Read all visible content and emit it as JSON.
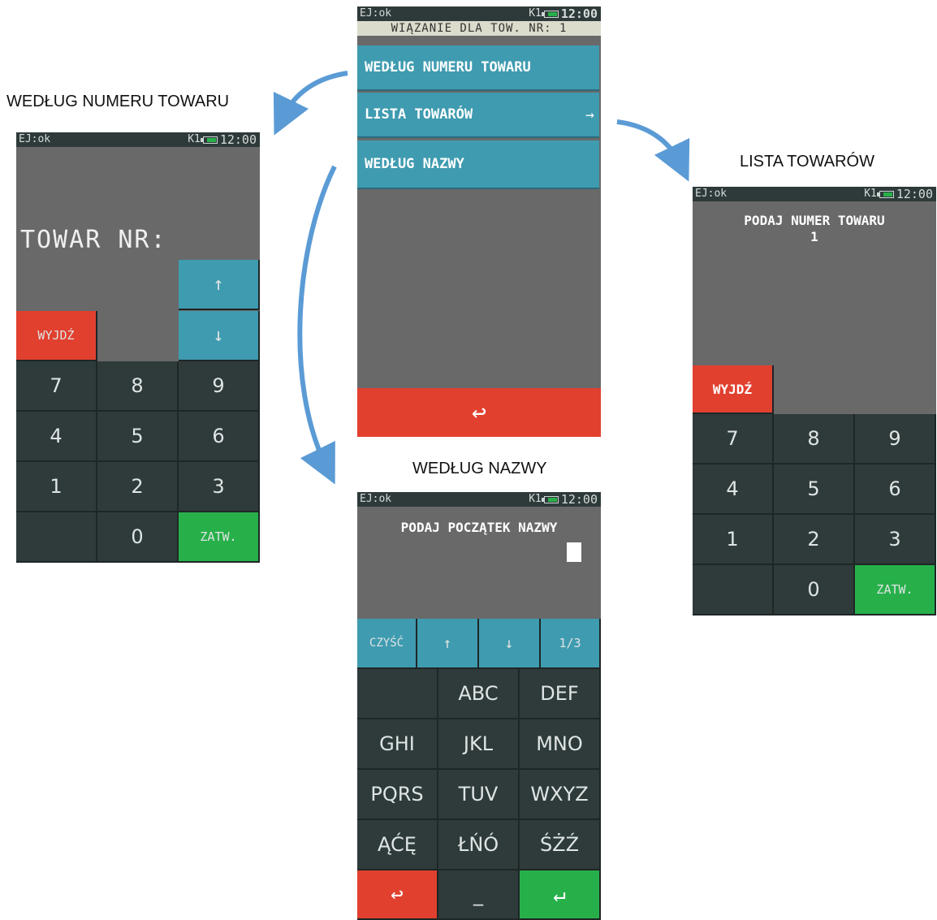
{
  "captions": {
    "left": "WEDŁUG NUMERU TOWARU",
    "right": "LISTA TOWARÓW",
    "bottom": "WEDŁUG NAZWY"
  },
  "status": {
    "ej": "EJ:ok",
    "k": "K1",
    "time": "12:00"
  },
  "main": {
    "header": "WIĄZANIE DLA TOW. NR: 1",
    "items": [
      "WEDŁUG NUMERU TOWARU",
      "LISTA TOWARÓW",
      "WEDŁUG NAZWY"
    ],
    "item_arrow": "→",
    "back_icon": "↩"
  },
  "left": {
    "label": "TOWAR NR:",
    "up": "↑",
    "down": "↓",
    "exit": "WYJDŹ",
    "keys": [
      "7",
      "8",
      "9",
      "4",
      "5",
      "6",
      "1",
      "2",
      "3"
    ],
    "zero": "0",
    "confirm": "ZATW."
  },
  "right": {
    "prompt": "PODAJ NUMER TOWARU",
    "value": "1",
    "exit": "WYJDŹ",
    "keys": [
      "7",
      "8",
      "9",
      "4",
      "5",
      "6",
      "1",
      "2",
      "3"
    ],
    "zero": "0",
    "confirm": "ZATW."
  },
  "name": {
    "prompt": "PODAJ POCZĄTEK NAZWY",
    "clear": "CZYŚĆ",
    "up": "↑",
    "down": "↓",
    "page": "1/3",
    "keys": [
      "",
      "ABC",
      "DEF",
      "GHI",
      "JKL",
      "MNO",
      "PQRS",
      "TUV",
      "WXYZ",
      "ĄĆĘ",
      "ŁŃÓ",
      "ŚŻŹ"
    ],
    "back_icon": "↩",
    "space": "_",
    "enter_icon": "↵"
  },
  "colors": {
    "accent_blue": "#3f9bb0",
    "red": "#e2402f",
    "green": "#27b04a",
    "key": "#2f3b3b",
    "screen": "#696969"
  }
}
